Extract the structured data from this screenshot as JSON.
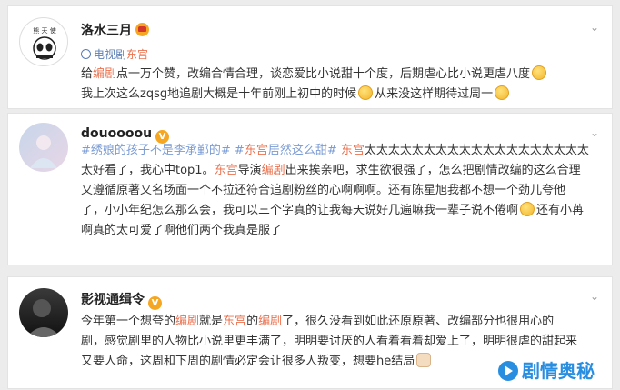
{
  "posts": [
    {
      "user": "洛水三月",
      "avatar_label": "熊 天 使",
      "source_label": "电视剧",
      "source_show": "东宫",
      "lines": [
        [
          "给",
          "编剧",
          "点一万个赞，改编合情合理，谈恋爱比小说甜十个度，后期虐心比小说更虐八度"
        ],
        [
          "我上次这么zqsg地追剧大概是十年前刚上初中的时候",
          "从来没这样期待过周一"
        ]
      ]
    },
    {
      "user": "douoooou",
      "lines": [
        [
          "#绣娘的孩子不是李承鄞的#",
          " #",
          "东宫",
          "居然这么甜#",
          " 东宫",
          "太太太太太太太太太太太太太太太太太太太"
        ],
        [
          "太好看了，我心中top1。",
          "东宫",
          "导演",
          "编剧",
          "出来挨亲吧，求生欲很强了，怎么把剧情改编的这么合理"
        ],
        [
          "又遵循原著又名场面一个不拉还符合追剧粉丝的心啊啊啊。还有陈星旭我都不想一个劲儿夸他"
        ],
        [
          "了，小小年纪怎么那么会，我可以三个字真的让我每天说好几遍嘛我一辈子说不倦啊",
          "还有小苒"
        ],
        [
          "啊真的太可爱了啊他们两个我真是服了"
        ]
      ]
    },
    {
      "user": "影视通缉令",
      "lines": [
        [
          "今年第一个想夸的",
          "编剧",
          "就是",
          "东宫",
          "的",
          "编剧",
          "了，很久没看到如此还原原著、改编部分也很用心的"
        ],
        [
          "剧，感觉剧里的人物比小说里更丰满了，明明要讨厌的人看着看着却爱上了，明明很虐的甜起来"
        ],
        [
          "又要人命，这周和下周的剧情必定会让很多人叛变，想要he结局"
        ]
      ]
    }
  ],
  "watermark": "剧情奥秘"
}
